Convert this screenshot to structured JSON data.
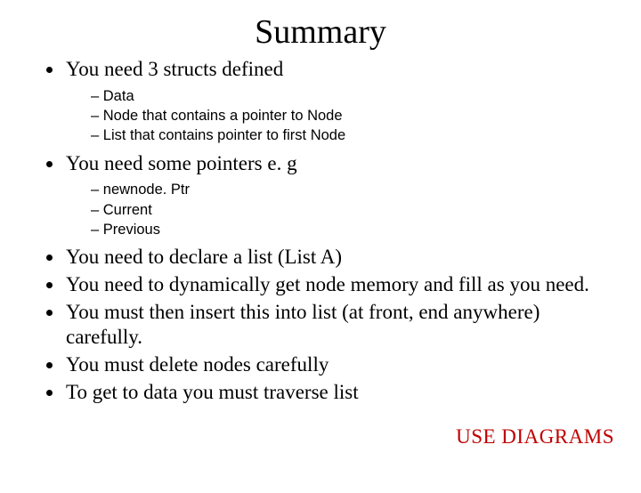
{
  "title": "Summary",
  "bullets": {
    "b0": {
      "text": "You need 3 structs defined"
    },
    "b1": {
      "text": "You need some pointers e. g"
    },
    "b2": {
      "text": "You need to declare a list (List A)"
    },
    "b3": {
      "text": "You need to dynamically get node memory and fill as you need."
    },
    "b4": {
      "text": "You must then insert this into list (at front, end anywhere) carefully."
    },
    "b5": {
      "text": "You must delete nodes carefully"
    },
    "b6": {
      "text": "To get to data you must traverse list"
    }
  },
  "sub0": {
    "s0": "Data",
    "s1": "Node that contains a pointer to Node",
    "s2": "List that contains pointer to first Node"
  },
  "sub1": {
    "s0": "newnode. Ptr",
    "s1": "Current",
    "s2": "Previous"
  },
  "callout": "USE DIAGRAMS"
}
